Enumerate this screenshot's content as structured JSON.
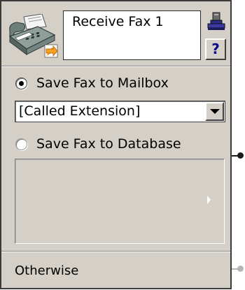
{
  "action": {
    "title": "Receive Fax 1",
    "icons": {
      "fax": "fax-machine-icon",
      "stamp": "stamp-icon",
      "help": "?"
    }
  },
  "options": {
    "mailbox": {
      "label": "Save Fax to Mailbox",
      "checked": true
    },
    "extension_dropdown": {
      "value": "[Called Extension]"
    },
    "database": {
      "label": "Save Fax to Database",
      "checked": false
    }
  },
  "otherwise": {
    "label": "Otherwise"
  },
  "colors": {
    "panel_bg": "#d4d0c8",
    "connector_active": "#1a1a1a",
    "connector_inactive": "#b5b5b5"
  }
}
